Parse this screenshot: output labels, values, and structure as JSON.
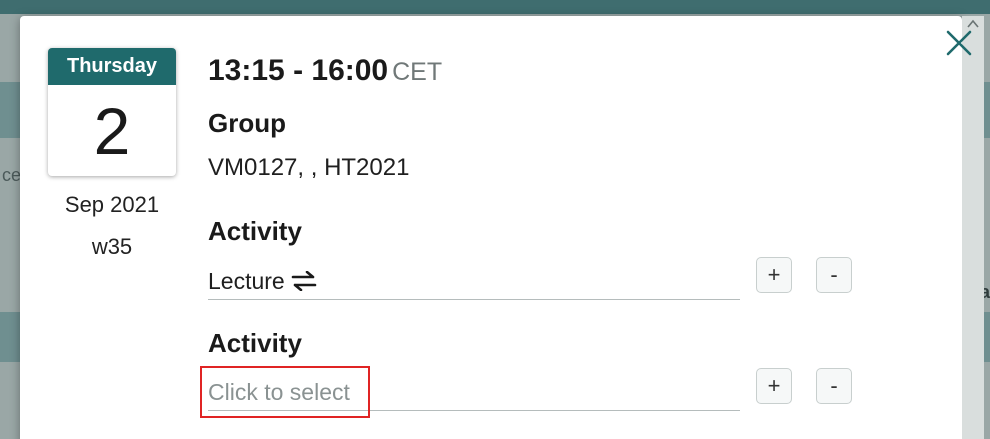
{
  "background": {
    "left_fragment": "ce",
    "right_fragment": "ar"
  },
  "event": {
    "weekday": "Thursday",
    "day": "2",
    "month_year": "Sep 2021",
    "week": "w35",
    "time_range": "13:15 - 16:00",
    "timezone": "CET"
  },
  "group": {
    "label": "Group",
    "value": "VM0127, , HT2021"
  },
  "activities": [
    {
      "label": "Activity",
      "value": "Lecture",
      "plus_label": "+",
      "minus_label": "-"
    },
    {
      "label": "Activity",
      "placeholder": "Click to select",
      "plus_label": "+",
      "minus_label": "-"
    }
  ],
  "icons": {
    "close": "close-icon",
    "swap": "swap-arrows-icon",
    "scroll_up": "chevron-up-icon"
  },
  "colors": {
    "accent": "#1f6a6c",
    "highlight": "#e02424"
  }
}
